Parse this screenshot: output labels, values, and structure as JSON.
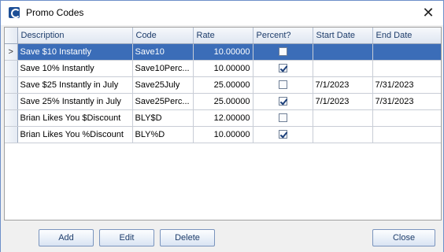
{
  "window": {
    "title": "Promo Codes"
  },
  "grid": {
    "columns": [
      "Description",
      "Code",
      "Rate",
      "Percent?",
      "Start Date",
      "End Date"
    ],
    "selected_row_marker": ">",
    "rows": [
      {
        "description": "Save $10 Instantly",
        "code": "Save10",
        "rate": "10.00000",
        "percent": false,
        "start_date": "",
        "end_date": ""
      },
      {
        "description": "Save 10% Instantly",
        "code": "Save10Perc...",
        "rate": "10.00000",
        "percent": true,
        "start_date": "",
        "end_date": ""
      },
      {
        "description": "Save $25 Instantly in July",
        "code": "Save25July",
        "rate": "25.00000",
        "percent": false,
        "start_date": "7/1/2023",
        "end_date": "7/31/2023"
      },
      {
        "description": "Save 25% Instantly in July",
        "code": "Save25Perc...",
        "rate": "25.00000",
        "percent": true,
        "start_date": "7/1/2023",
        "end_date": "7/31/2023"
      },
      {
        "description": "Brian Likes You $Discount",
        "code": "BLY$D",
        "rate": "12.00000",
        "percent": false,
        "start_date": "",
        "end_date": ""
      },
      {
        "description": "Brian Likes You %Discount",
        "code": "BLY%D",
        "rate": "10.00000",
        "percent": true,
        "start_date": "",
        "end_date": ""
      }
    ]
  },
  "buttons": {
    "add": "Add",
    "edit": "Edit",
    "delete": "Delete",
    "close": "Close"
  }
}
